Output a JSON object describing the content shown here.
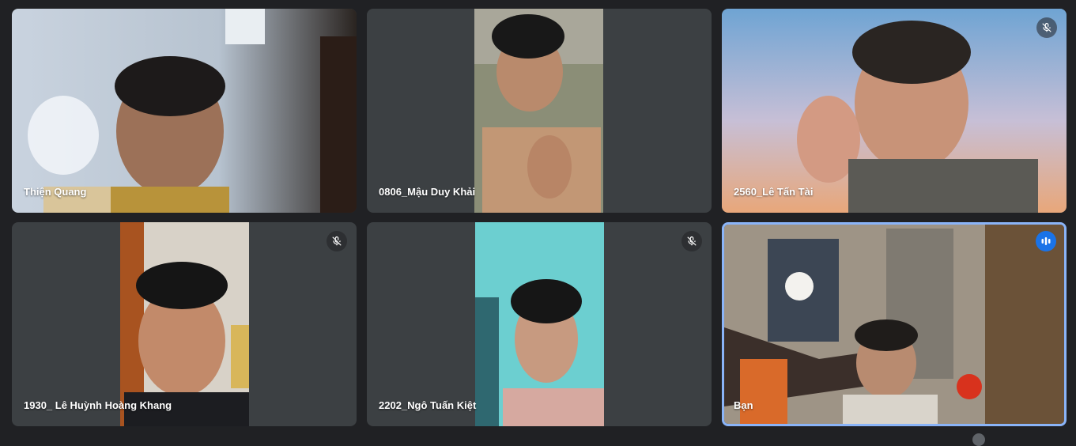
{
  "participants": [
    {
      "name": "Thiện Quang",
      "muted": false
    },
    {
      "name": "0806_Mậu Duy Khải",
      "muted": false
    },
    {
      "name": "2560_Lê Tấn Tài",
      "muted": true
    },
    {
      "name": "1930_ Lê Huỳnh Hoàng Khang",
      "muted": true
    },
    {
      "name": "2202_Ngô Tuấn Kiệt",
      "muted": true
    },
    {
      "name": "Bạn",
      "muted": false,
      "speaking": true
    }
  ],
  "icons": {
    "mic_off": "mic-off-icon",
    "speaking": "speaking-indicator-icon"
  },
  "colors": {
    "background": "#202124",
    "tile": "#3c4043",
    "active_border": "#8ab4f8",
    "speaking_badge": "#1a73e8"
  }
}
